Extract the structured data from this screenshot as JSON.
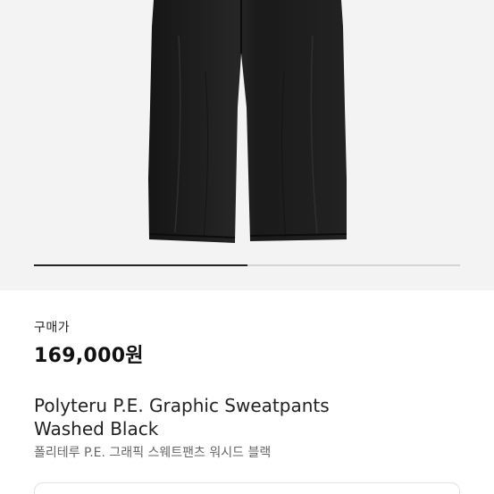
{
  "product": {
    "price_label": "구매가",
    "price": "169,000원",
    "title_line1": "Polyteru P.E. Graphic Sweatpants",
    "title_line2": "Washed Black",
    "subtitle": "폴리테루 P.E. 그래픽 스웨트팬츠 워시드 블랙"
  },
  "gallery": {
    "progress": 0.5,
    "image_alt": "black sweatpants"
  },
  "colors": {
    "hero_bg": "#f3f3f3",
    "pants": "#1f1f1f",
    "progress_fill": "#222222",
    "progress_track": "#d4d4d4"
  }
}
